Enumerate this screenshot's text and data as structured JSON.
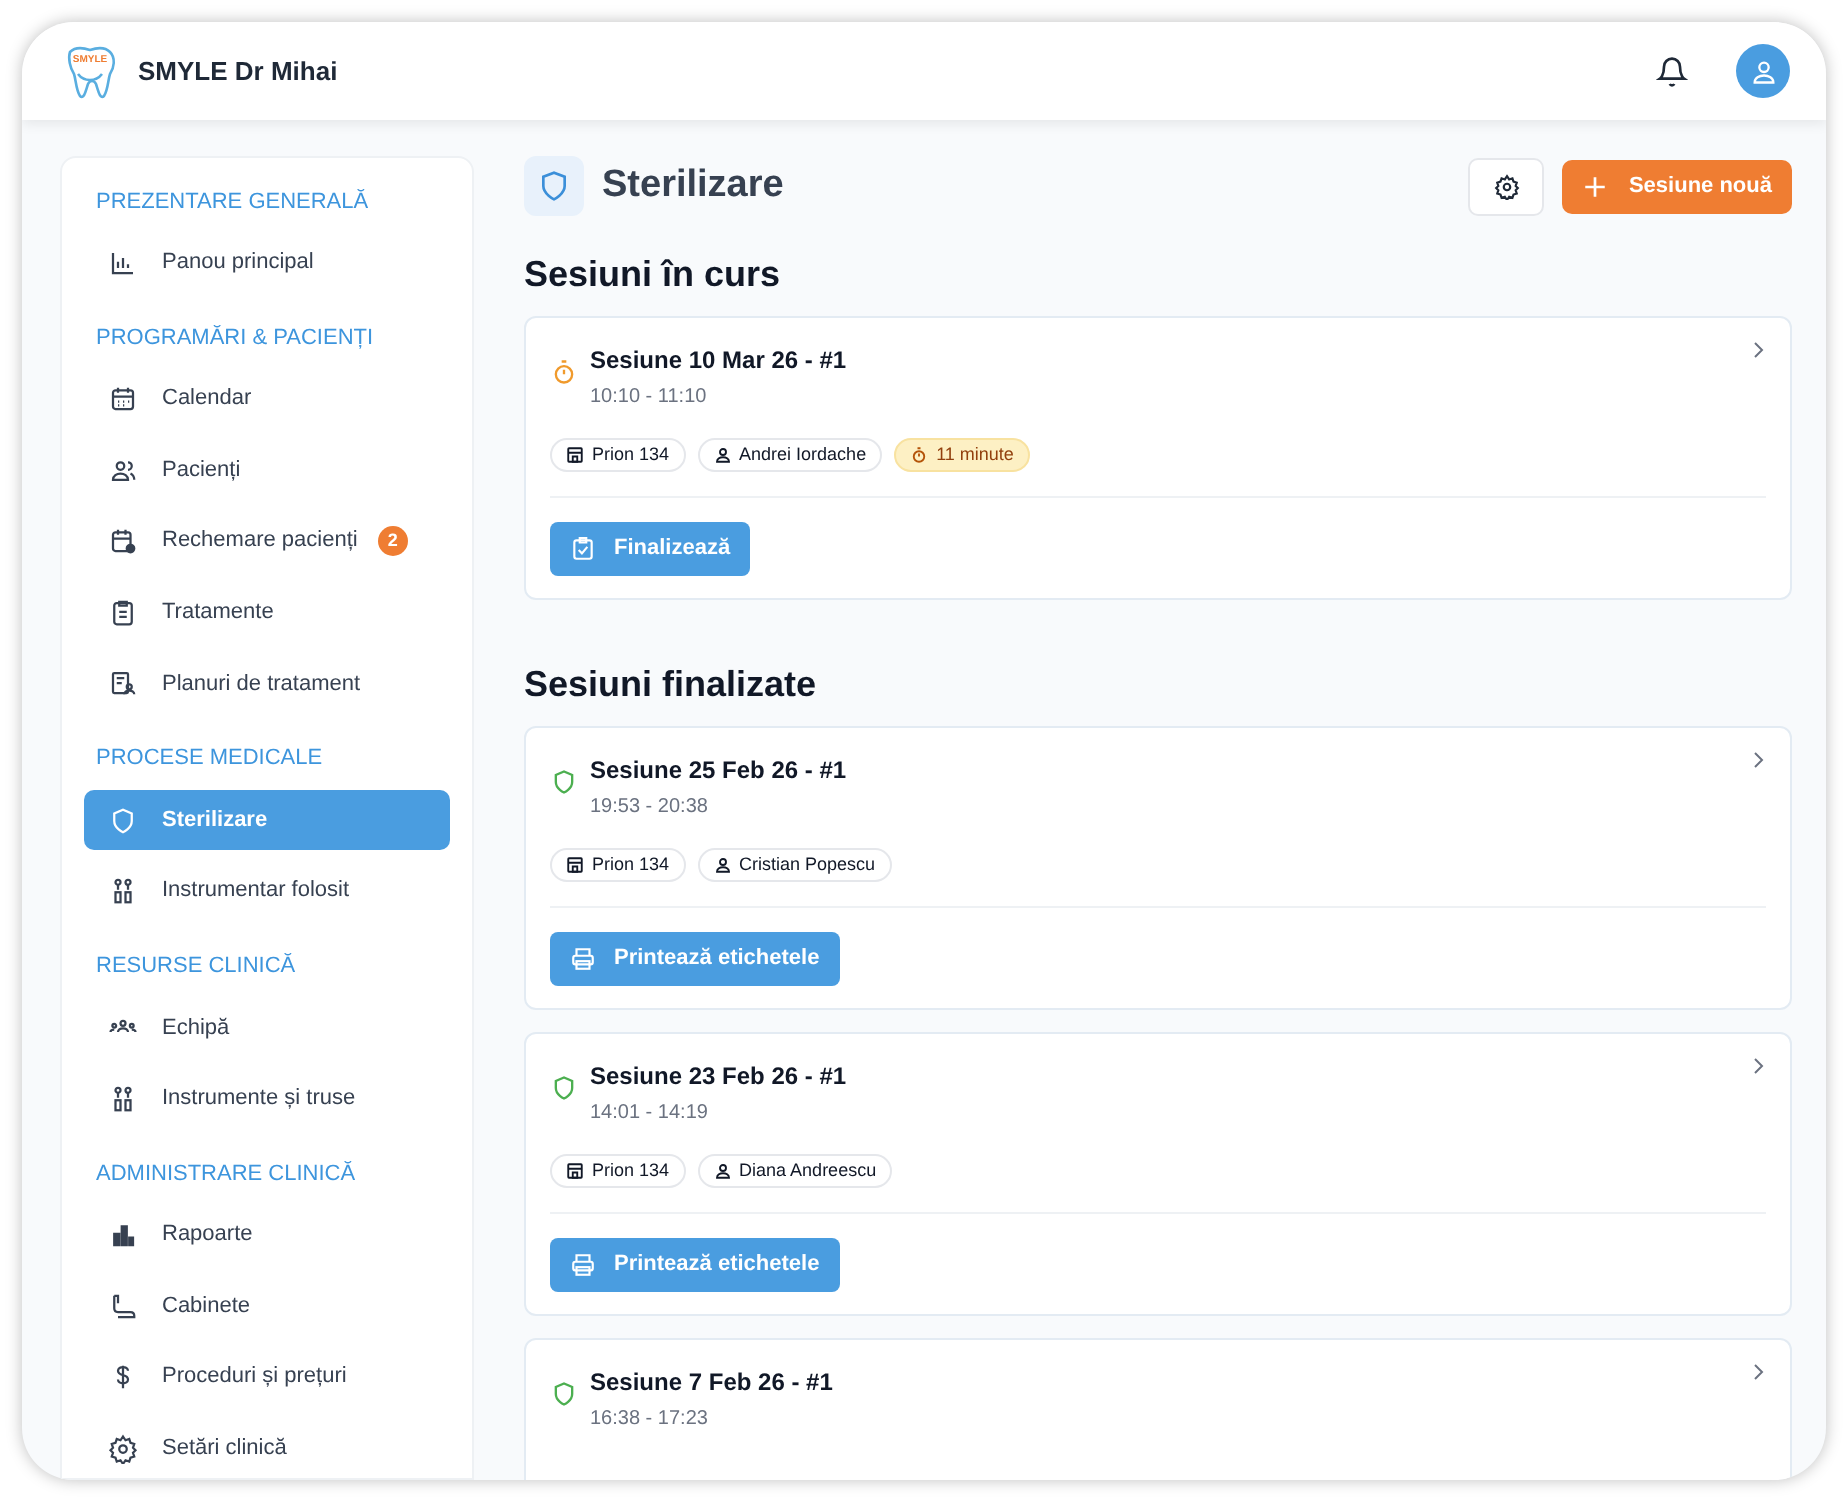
{
  "header": {
    "brand": "SMYLE Dr Mihai",
    "logo_text": "SMYLE"
  },
  "sidebar": {
    "sections": [
      {
        "title": "PREZENTARE GENERALĂ",
        "items": [
          {
            "label": "Panou principal",
            "selected": false
          }
        ]
      },
      {
        "title": "PROGRAMĂRI & PACIENȚI",
        "items": [
          {
            "label": "Calendar",
            "selected": false
          },
          {
            "label": "Pacienți",
            "selected": false
          },
          {
            "label": "Rechemare pacienți",
            "selected": false,
            "badge": "2"
          },
          {
            "label": "Tratamente",
            "selected": false
          },
          {
            "label": "Planuri de tratament",
            "selected": false
          }
        ]
      },
      {
        "title": "PROCESE MEDICALE",
        "items": [
          {
            "label": "Sterilizare",
            "selected": true
          },
          {
            "label": "Instrumentar folosit",
            "selected": false
          }
        ]
      },
      {
        "title": "RESURSE CLINICĂ",
        "items": [
          {
            "label": "Echipă",
            "selected": false
          },
          {
            "label": "Instrumente și truse",
            "selected": false
          }
        ]
      },
      {
        "title": "ADMINISTRARE CLINICĂ",
        "items": [
          {
            "label": "Rapoarte",
            "selected": false
          },
          {
            "label": "Cabinete",
            "selected": false
          },
          {
            "label": "Proceduri și prețuri",
            "selected": false
          },
          {
            "label": "Setări clinică",
            "selected": false
          }
        ]
      }
    ]
  },
  "page": {
    "title": "Sterilizare",
    "new_button": "Sesiune nouă"
  },
  "groups": [
    {
      "title": "Sesiuni în curs",
      "sessions": [
        {
          "kind": "in_progress",
          "title": "Sesiune 10 Mar 26 - #1",
          "time": "10:10 - 11:10",
          "device": "Prion 134",
          "person": "Andrei Iordache",
          "duration": "11 minute",
          "action": "Finalizează"
        }
      ]
    },
    {
      "title": "Sesiuni finalizate",
      "sessions": [
        {
          "kind": "done",
          "title": "Sesiune 25 Feb 26 - #1",
          "time": "19:53 - 20:38",
          "device": "Prion 134",
          "person": "Cristian Popescu",
          "action": "Printează etichetele"
        },
        {
          "kind": "done",
          "title": "Sesiune 23 Feb 26 - #1",
          "time": "14:01 - 14:19",
          "device": "Prion 134",
          "person": "Diana Andreescu",
          "action": "Printează etichetele"
        },
        {
          "kind": "done",
          "title": "Sesiune 7 Feb 26 - #1",
          "time": "16:38 - 17:23"
        }
      ]
    }
  ]
}
